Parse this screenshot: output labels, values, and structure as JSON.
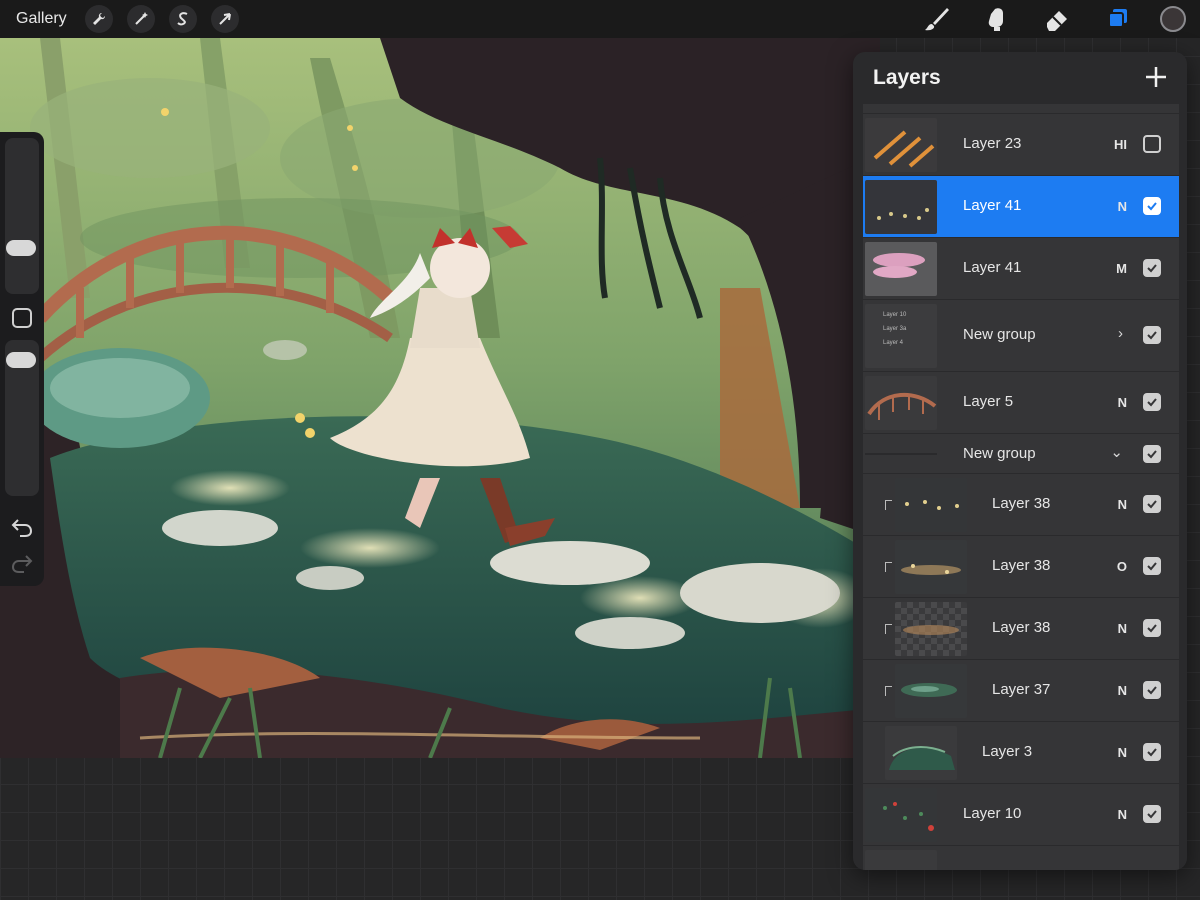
{
  "topbar": {
    "gallery_label": "Gallery",
    "adjust_tools": [
      "wrench-icon",
      "magic-wand-icon",
      "selection-s-icon",
      "arrow-cursor-icon"
    ],
    "right_tools": [
      "brush-icon",
      "smudge-icon",
      "eraser-icon",
      "layers-icon"
    ],
    "active_tool": "layers-icon",
    "current_color": "#3b3637"
  },
  "layers_panel": {
    "title": "Layers",
    "add_label": "+",
    "layers": [
      {
        "name": "Layer 23",
        "mode": "HI",
        "visible": false,
        "selected": false,
        "kind": "layer",
        "clipped": false
      },
      {
        "name": "Layer 41",
        "mode": "N",
        "visible": true,
        "selected": true,
        "kind": "layer",
        "clipped": false
      },
      {
        "name": "Layer 41",
        "mode": "M",
        "visible": true,
        "selected": false,
        "kind": "layer",
        "clipped": false
      },
      {
        "name": "New group",
        "mode": "›",
        "visible": true,
        "selected": false,
        "kind": "group-collapsed",
        "clipped": false
      },
      {
        "name": "Layer 5",
        "mode": "N",
        "visible": true,
        "selected": false,
        "kind": "layer",
        "clipped": false
      },
      {
        "name": "New group",
        "mode": "⌄",
        "visible": true,
        "selected": false,
        "kind": "group-expanded",
        "clipped": false
      },
      {
        "name": "Layer 38",
        "mode": "N",
        "visible": true,
        "selected": false,
        "kind": "layer",
        "clipped": true
      },
      {
        "name": "Layer 38",
        "mode": "O",
        "visible": true,
        "selected": false,
        "kind": "layer",
        "clipped": true
      },
      {
        "name": "Layer 38",
        "mode": "N",
        "visible": true,
        "selected": false,
        "kind": "layer",
        "clipped": true
      },
      {
        "name": "Layer 37",
        "mode": "N",
        "visible": true,
        "selected": false,
        "kind": "layer",
        "clipped": true
      },
      {
        "name": "Layer 3",
        "mode": "N",
        "visible": true,
        "selected": false,
        "kind": "layer",
        "clipped": false
      },
      {
        "name": "Layer 10",
        "mode": "N",
        "visible": true,
        "selected": false,
        "kind": "layer",
        "clipped": false
      }
    ],
    "group_preview_labels": [
      "Layer 10",
      "Layer 3a",
      "Layer 4"
    ]
  },
  "colors": {
    "selection_blue": "#1d7cf2",
    "panel_bg": "#2a2a2c",
    "row_bg": "#353537"
  }
}
